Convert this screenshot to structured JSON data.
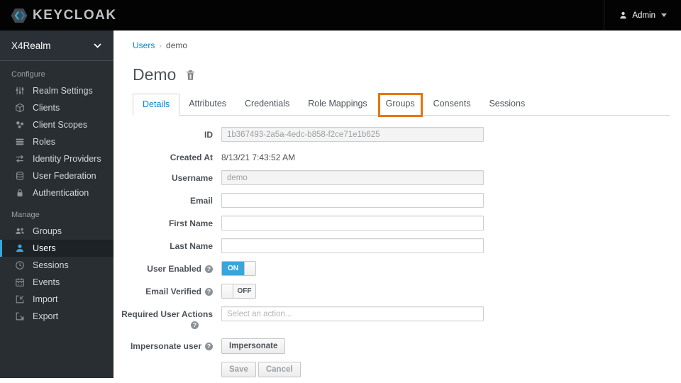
{
  "colors": {
    "header_bg": "#030303",
    "sidebar_bg": "#292e33",
    "accent_blue": "#0088ce",
    "toggle_on_blue": "#39a5dc",
    "active_item_border": "#39a5dc",
    "annotation_orange": "#e87509"
  },
  "icons": {
    "help": "?"
  },
  "header": {
    "brand": "KEYCLOAK",
    "user": {
      "label": "Admin"
    }
  },
  "sidebar": {
    "realm_selector": {
      "label": "X4Realm"
    },
    "sections": [
      {
        "label": "Configure",
        "items": [
          {
            "label": "Realm Settings",
            "icon": "sliders-icon"
          },
          {
            "label": "Clients",
            "icon": "cube-icon"
          },
          {
            "label": "Client Scopes",
            "icon": "cluster-icon"
          },
          {
            "label": "Roles",
            "icon": "layers-icon"
          },
          {
            "label": "Identity Providers",
            "icon": "exchange-arrows-icon"
          },
          {
            "label": "User Federation",
            "icon": "database-icon"
          },
          {
            "label": "Authentication",
            "icon": "lock-icon"
          }
        ]
      },
      {
        "label": "Manage",
        "items": [
          {
            "label": "Groups",
            "icon": "group-icon"
          },
          {
            "label": "Users",
            "icon": "user-icon",
            "active": true
          },
          {
            "label": "Sessions",
            "icon": "clock-icon"
          },
          {
            "label": "Events",
            "icon": "calendar-icon"
          },
          {
            "label": "Import",
            "icon": "import-icon"
          },
          {
            "label": "Export",
            "icon": "export-icon"
          }
        ]
      }
    ]
  },
  "breadcrumb": {
    "parent": "Users",
    "separator": "›",
    "current": "demo"
  },
  "page": {
    "title": "Demo"
  },
  "tabs": [
    {
      "label": "Details",
      "active": true
    },
    {
      "label": "Attributes"
    },
    {
      "label": "Credentials"
    },
    {
      "label": "Role Mappings"
    },
    {
      "label": "Groups",
      "annotated": true
    },
    {
      "label": "Consents"
    },
    {
      "label": "Sessions"
    }
  ],
  "form": {
    "id": {
      "label": "ID",
      "value": "1b367493-2a5a-4edc-b858-f2ce71e1b625"
    },
    "created_at": {
      "label": "Created At",
      "value": "8/13/21 7:43:52 AM"
    },
    "username": {
      "label": "Username",
      "value": "demo"
    },
    "email": {
      "label": "Email",
      "value": ""
    },
    "first_name": {
      "label": "First Name",
      "value": ""
    },
    "last_name": {
      "label": "Last Name",
      "value": ""
    },
    "user_enabled": {
      "label": "User Enabled",
      "state": "ON"
    },
    "email_verified": {
      "label": "Email Verified",
      "state": "OFF"
    },
    "required_user_actions": {
      "label": "Required User Actions",
      "placeholder": "Select an action..."
    },
    "impersonate": {
      "label": "Impersonate user",
      "button_label": "Impersonate"
    },
    "buttons": {
      "save": "Save",
      "cancel": "Cancel"
    }
  }
}
